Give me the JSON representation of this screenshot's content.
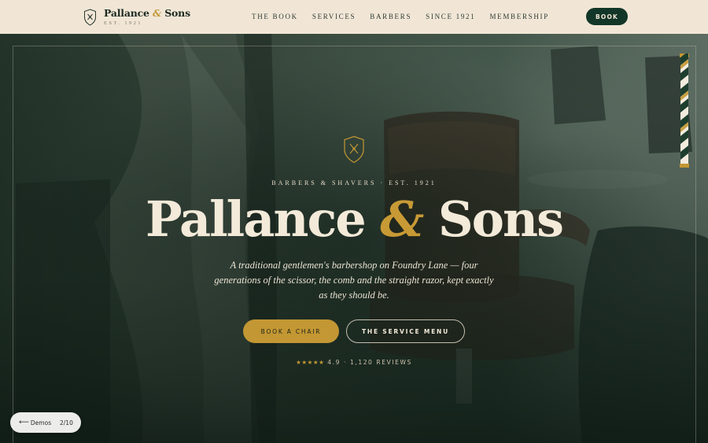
{
  "header": {
    "brand": {
      "name_a": "Pallance",
      "amp": "&",
      "name_b": "Sons",
      "est": "EST. 1921"
    },
    "nav": [
      {
        "label": "THE BOOK"
      },
      {
        "label": "SERVICES"
      },
      {
        "label": "BARBERS"
      },
      {
        "label": "SINCE 1921"
      },
      {
        "label": "MEMBERSHIP"
      }
    ],
    "book_label": "BOOK"
  },
  "hero": {
    "eyebrow": "BARBERS & SHAVERS · EST. 1921",
    "title_a": "Pallance",
    "title_amp": "&",
    "title_b": "Sons",
    "description": "A traditional gentlemen's barbershop on Foundry Lane — four generations of the scissor, the comb and the straight razor, kept exactly as they should be.",
    "cta_primary": "BOOK A CHAIR",
    "cta_secondary": "THE SERVICE MENU",
    "rating": {
      "stars": "★★★★★",
      "text": "4.9 · 1,120 REVIEWS",
      "value": 4.9
    }
  },
  "demo": {
    "back_arrow": "⟵",
    "back_label": "Demos",
    "counter": "2/10"
  },
  "colors": {
    "header_bg": "#f1e6d6",
    "dark_green": "#123628",
    "gold": "#c39733",
    "cream": "#f3ead9"
  },
  "icons": {
    "brand_crest": "shield-razor-icon",
    "hero_crest": "shield-razor-icon",
    "stars": "star-icon"
  }
}
